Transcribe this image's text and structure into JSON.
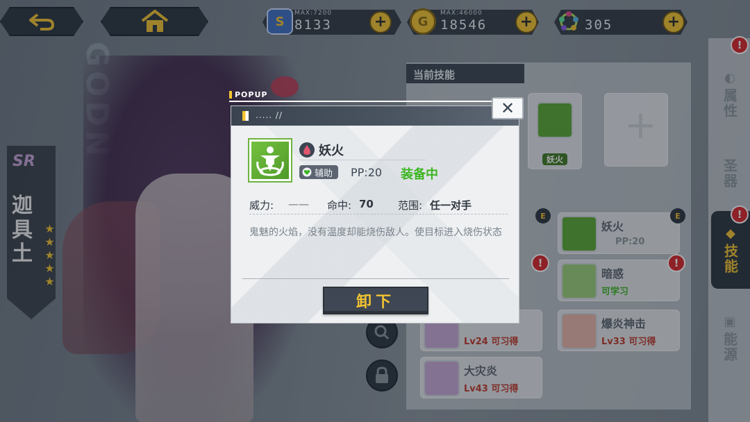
{
  "topbar": {
    "back_icon": "back-arrow-icon",
    "home_icon": "home-icon",
    "resources": [
      {
        "icon": "stamina-card-icon",
        "max_label": "MAX:7200",
        "value": "8133"
      },
      {
        "icon": "gold-coin-icon",
        "max_label": "MAX:46000",
        "value": "18546"
      },
      {
        "icon": "gem-cluster-icon",
        "max_label": "",
        "value": "305"
      }
    ],
    "plus_label": "+"
  },
  "side_tabs": [
    {
      "label": "属性",
      "icon": "attribute-icon",
      "alert": "!"
    },
    {
      "label": "圣器",
      "icon": "relic-icon",
      "alert": ""
    },
    {
      "label": "技能",
      "icon": "skill-icon",
      "alert": "!"
    },
    {
      "label": "能源",
      "icon": "energy-icon",
      "alert": ""
    }
  ],
  "character": {
    "rarity": "SR",
    "name": "迦具土",
    "stars": "★★★★★",
    "bg_letters": "GODN"
  },
  "skill_panel": {
    "title": "当前技能",
    "equipped_slot_name": "妖火",
    "list": [
      {
        "name": "妖火",
        "sub": "PP:20",
        "sub_color": "#8a939c"
      },
      {
        "name": "暗惑",
        "sub": "可学习",
        "sub_color": "#3cb521"
      },
      {
        "name": "",
        "sub": "Lv24 可习得",
        "sub_color": "#c0392b"
      },
      {
        "name": "爆炎神击",
        "sub": "Lv33 可习得",
        "sub_color": "#c0392b"
      },
      {
        "name": "大灾炎",
        "sub": "Lv43 可习得",
        "sub_color": "#c0392b"
      }
    ],
    "e_chip": "E"
  },
  "popup": {
    "label": "POPUP",
    "header_text": "..... //",
    "close_label": "✕",
    "skill": {
      "name": "妖火",
      "element_icon": "fire-drop-icon",
      "category": "辅助",
      "pp": "PP:20",
      "status": "装备中",
      "power_label": "威力:",
      "power_value": "——",
      "accuracy_label": "命中:",
      "accuracy_value": "70",
      "range_label": "范围:",
      "range_value": "任一对手",
      "description": "鬼魅的火焰，没有温度却能烧伤敌人。使目标进入烧伤状态"
    },
    "button_label": "卸下"
  },
  "colors": {
    "accent_yellow": "#f4c431",
    "panel_dark": "#2b3440",
    "equipped_green": "#3cb521",
    "alert_red": "#d9262b"
  }
}
